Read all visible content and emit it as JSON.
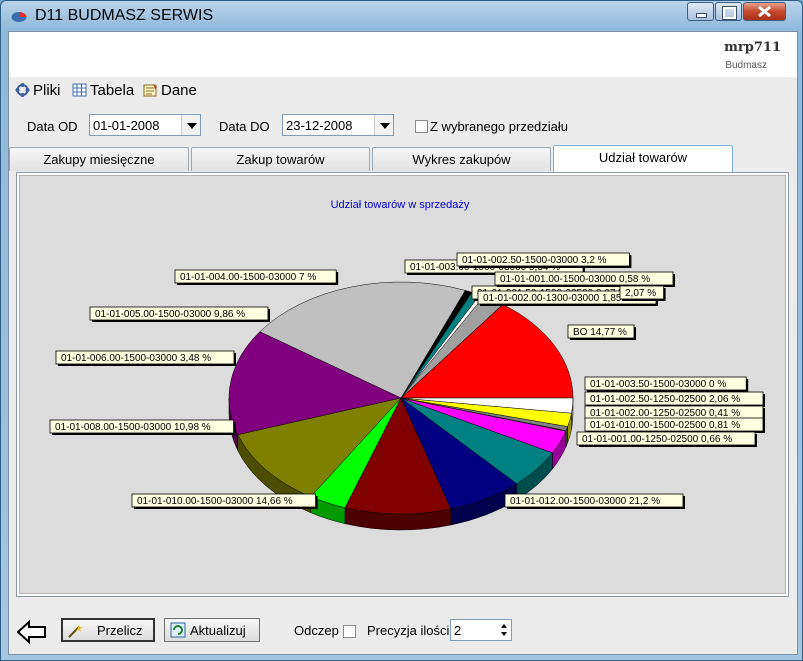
{
  "window": {
    "title": "D11 BUDMASZ SERWIS"
  },
  "brand": {
    "name": "mrp711",
    "sub": "Budmasz"
  },
  "menu": [
    {
      "label": "Pliki",
      "icon": "files-icon"
    },
    {
      "label": "Tabela",
      "icon": "table-icon"
    },
    {
      "label": "Dane",
      "icon": "data-icon"
    }
  ],
  "filters": {
    "od_label": "Data OD",
    "od_value": "01-01-2008",
    "do_label": "Data DO",
    "do_value": "23-12-2008",
    "range_label": "Z wybranego przedziału"
  },
  "tabs": [
    {
      "label": "Zakupy miesięczne"
    },
    {
      "label": "Zakup towarów"
    },
    {
      "label": "Wykres zakupów"
    },
    {
      "label": "Udział towarów"
    }
  ],
  "chart_data": {
    "type": "pie",
    "title": "Udział towarów w sprzedaży",
    "slices": [
      {
        "label": "BO 14,77 %",
        "value": 14.77,
        "color": "#ff0000"
      },
      {
        "label": "01-01-003.50-1500-03000 0 %",
        "value": 0.01,
        "color": "#ffffff"
      },
      {
        "label": "01-01-002.50-1250-02500 2,06 %",
        "value": 2.06,
        "color": "#a0a0a0"
      },
      {
        "label": "01-01-002.00-1250-02500 0,41 %",
        "value": 0.41,
        "color": "#ffffff"
      },
      {
        "label": "01-01-010.00-1500-02500 0,81 %",
        "value": 0.81,
        "color": "#008080"
      },
      {
        "label": "01-01-001.00-1250-02500 0,66 %",
        "value": 0.66,
        "color": "#000000"
      },
      {
        "label": "01-01-012.00-1500-03000 21,2 %",
        "value": 21.2,
        "color": "#c0c0c0"
      },
      {
        "label": "01-01-010.00-1500-03000 14,66 %",
        "value": 14.66,
        "color": "#800080"
      },
      {
        "label": "01-01-008.00-1500-03000 10,98 %",
        "value": 10.98,
        "color": "#808000"
      },
      {
        "label": "01-01-006.00-1500-03000 3,48 %",
        "value": 3.48,
        "color": "#00ff00"
      },
      {
        "label": "01-01-005.00-1500-03000 9,86 %",
        "value": 9.86,
        "color": "#800000"
      },
      {
        "label": "01-01-004.00-1500-03000 7 %",
        "value": 7.0,
        "color": "#000080"
      },
      {
        "label": "01-01-003.00-1500-03000 5,34 %",
        "value": 5.34,
        "color": "#008080"
      },
      {
        "label": "01-01-002.50-1500-03000 3,2 %",
        "value": 3.2,
        "color": "#ff00ff"
      },
      {
        "label": "01-01-001.50-1500-02500 0,07 %",
        "value": 0.07,
        "color": "#c0c0c0"
      },
      {
        "label": "01-01-001.00-1500-03000 0,58 %",
        "value": 0.58,
        "color": "#808080"
      },
      {
        "label": "01-01-002.00-1300-03000 1,85 %",
        "value": 1.85,
        "color": "#ffff00"
      },
      {
        "label": "2,07 %",
        "value": 2.07,
        "color": "#ffffff"
      }
    ]
  },
  "bottom": {
    "przelicz": "Przelicz",
    "aktualizuj": "Aktualizuj",
    "odczep": "Odczep",
    "precyzja_label": "Precyzja ilości",
    "precyzja_value": "2"
  }
}
